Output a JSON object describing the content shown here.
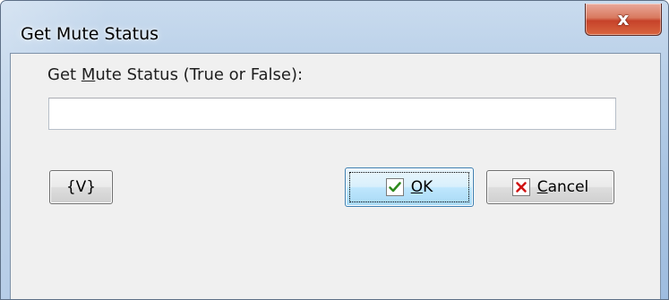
{
  "window": {
    "title": "Get Mute Status",
    "close_glyph": "x"
  },
  "form": {
    "label_prefix": "Get ",
    "label_mnemonic": "M",
    "label_suffix": "ute Status (True or False):",
    "input_value": ""
  },
  "buttons": {
    "variable_label": "{V}",
    "ok_mnemonic": "O",
    "ok_rest": "K",
    "cancel_mnemonic": "C",
    "cancel_rest": "ancel"
  },
  "icons": {
    "ok": "check-icon",
    "cancel": "x-mark-icon",
    "close": "close-icon"
  },
  "colors": {
    "check": "#2f8a1e",
    "cancel_x": "#d01414",
    "close_button": "#c6422a",
    "focus_button_border": "#3c7fb1"
  }
}
